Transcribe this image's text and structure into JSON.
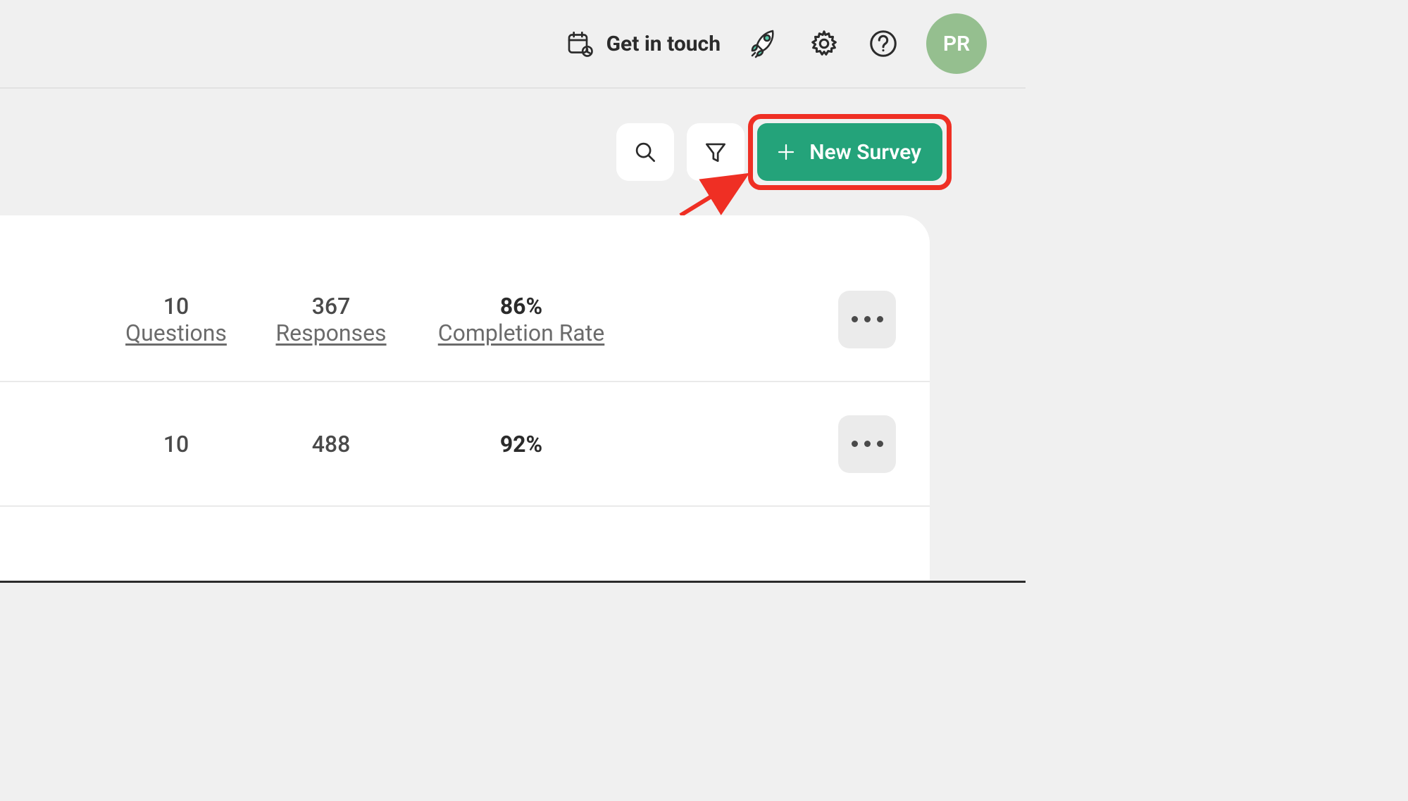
{
  "header": {
    "get_in_touch_label": "Get in touch",
    "avatar_initials": "PR"
  },
  "toolbar": {
    "new_survey_label": "New Survey"
  },
  "labels": {
    "questions": "Questions",
    "responses": "Responses",
    "completion_rate": "Completion Rate"
  },
  "rows": [
    {
      "questions": "10",
      "responses": "367",
      "completion": "86%"
    },
    {
      "questions": "10",
      "responses": "488",
      "completion": "92%"
    }
  ],
  "colors": {
    "accent_green": "#24a37a",
    "highlight_red": "#ef2f24",
    "avatar_bg": "#95bf8f"
  }
}
